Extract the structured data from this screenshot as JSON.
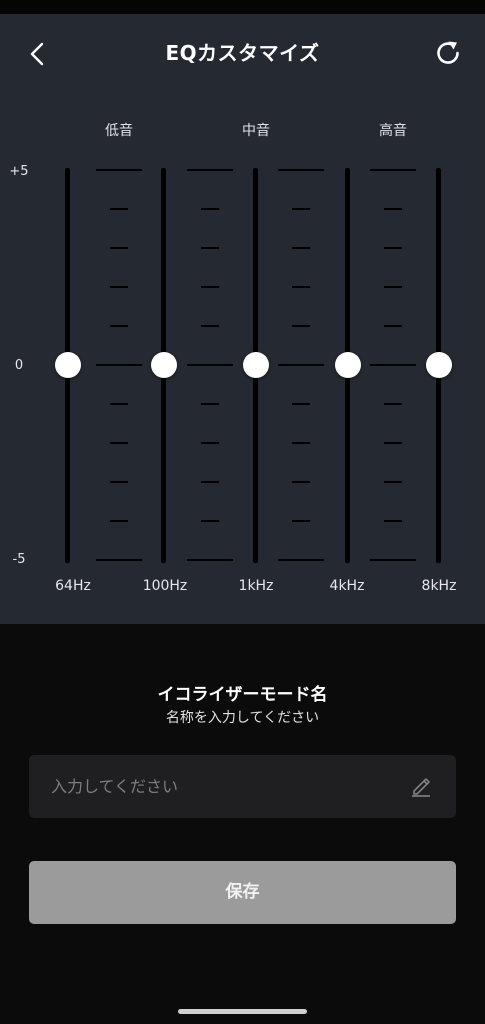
{
  "header": {
    "title": "EQカスタマイズ",
    "back_icon": "chevron-left-icon",
    "reset_icon": "refresh-icon"
  },
  "eq": {
    "band_labels": [
      "低音",
      "中音",
      "高音"
    ],
    "db_labels": {
      "max": "+5",
      "mid": "0",
      "min": "-5"
    },
    "range_db": [
      -5,
      5
    ],
    "sliders": [
      {
        "freq": "64Hz",
        "gain_db": 0
      },
      {
        "freq": "100Hz",
        "gain_db": 0
      },
      {
        "freq": "1kHz",
        "gain_db": 0
      },
      {
        "freq": "4kHz",
        "gain_db": 0
      },
      {
        "freq": "8kHz",
        "gain_db": 0
      }
    ]
  },
  "mode": {
    "title": "イコライザーモード名",
    "subtitle": "名称を入力してください",
    "input_placeholder": "入力してください",
    "input_value": "",
    "edit_icon": "pencil-icon",
    "save_label": "保存"
  },
  "colors": {
    "panel_bg": "#252932",
    "page_bg": "#0b0b0c",
    "save_button_bg": "#9b9b9b"
  }
}
